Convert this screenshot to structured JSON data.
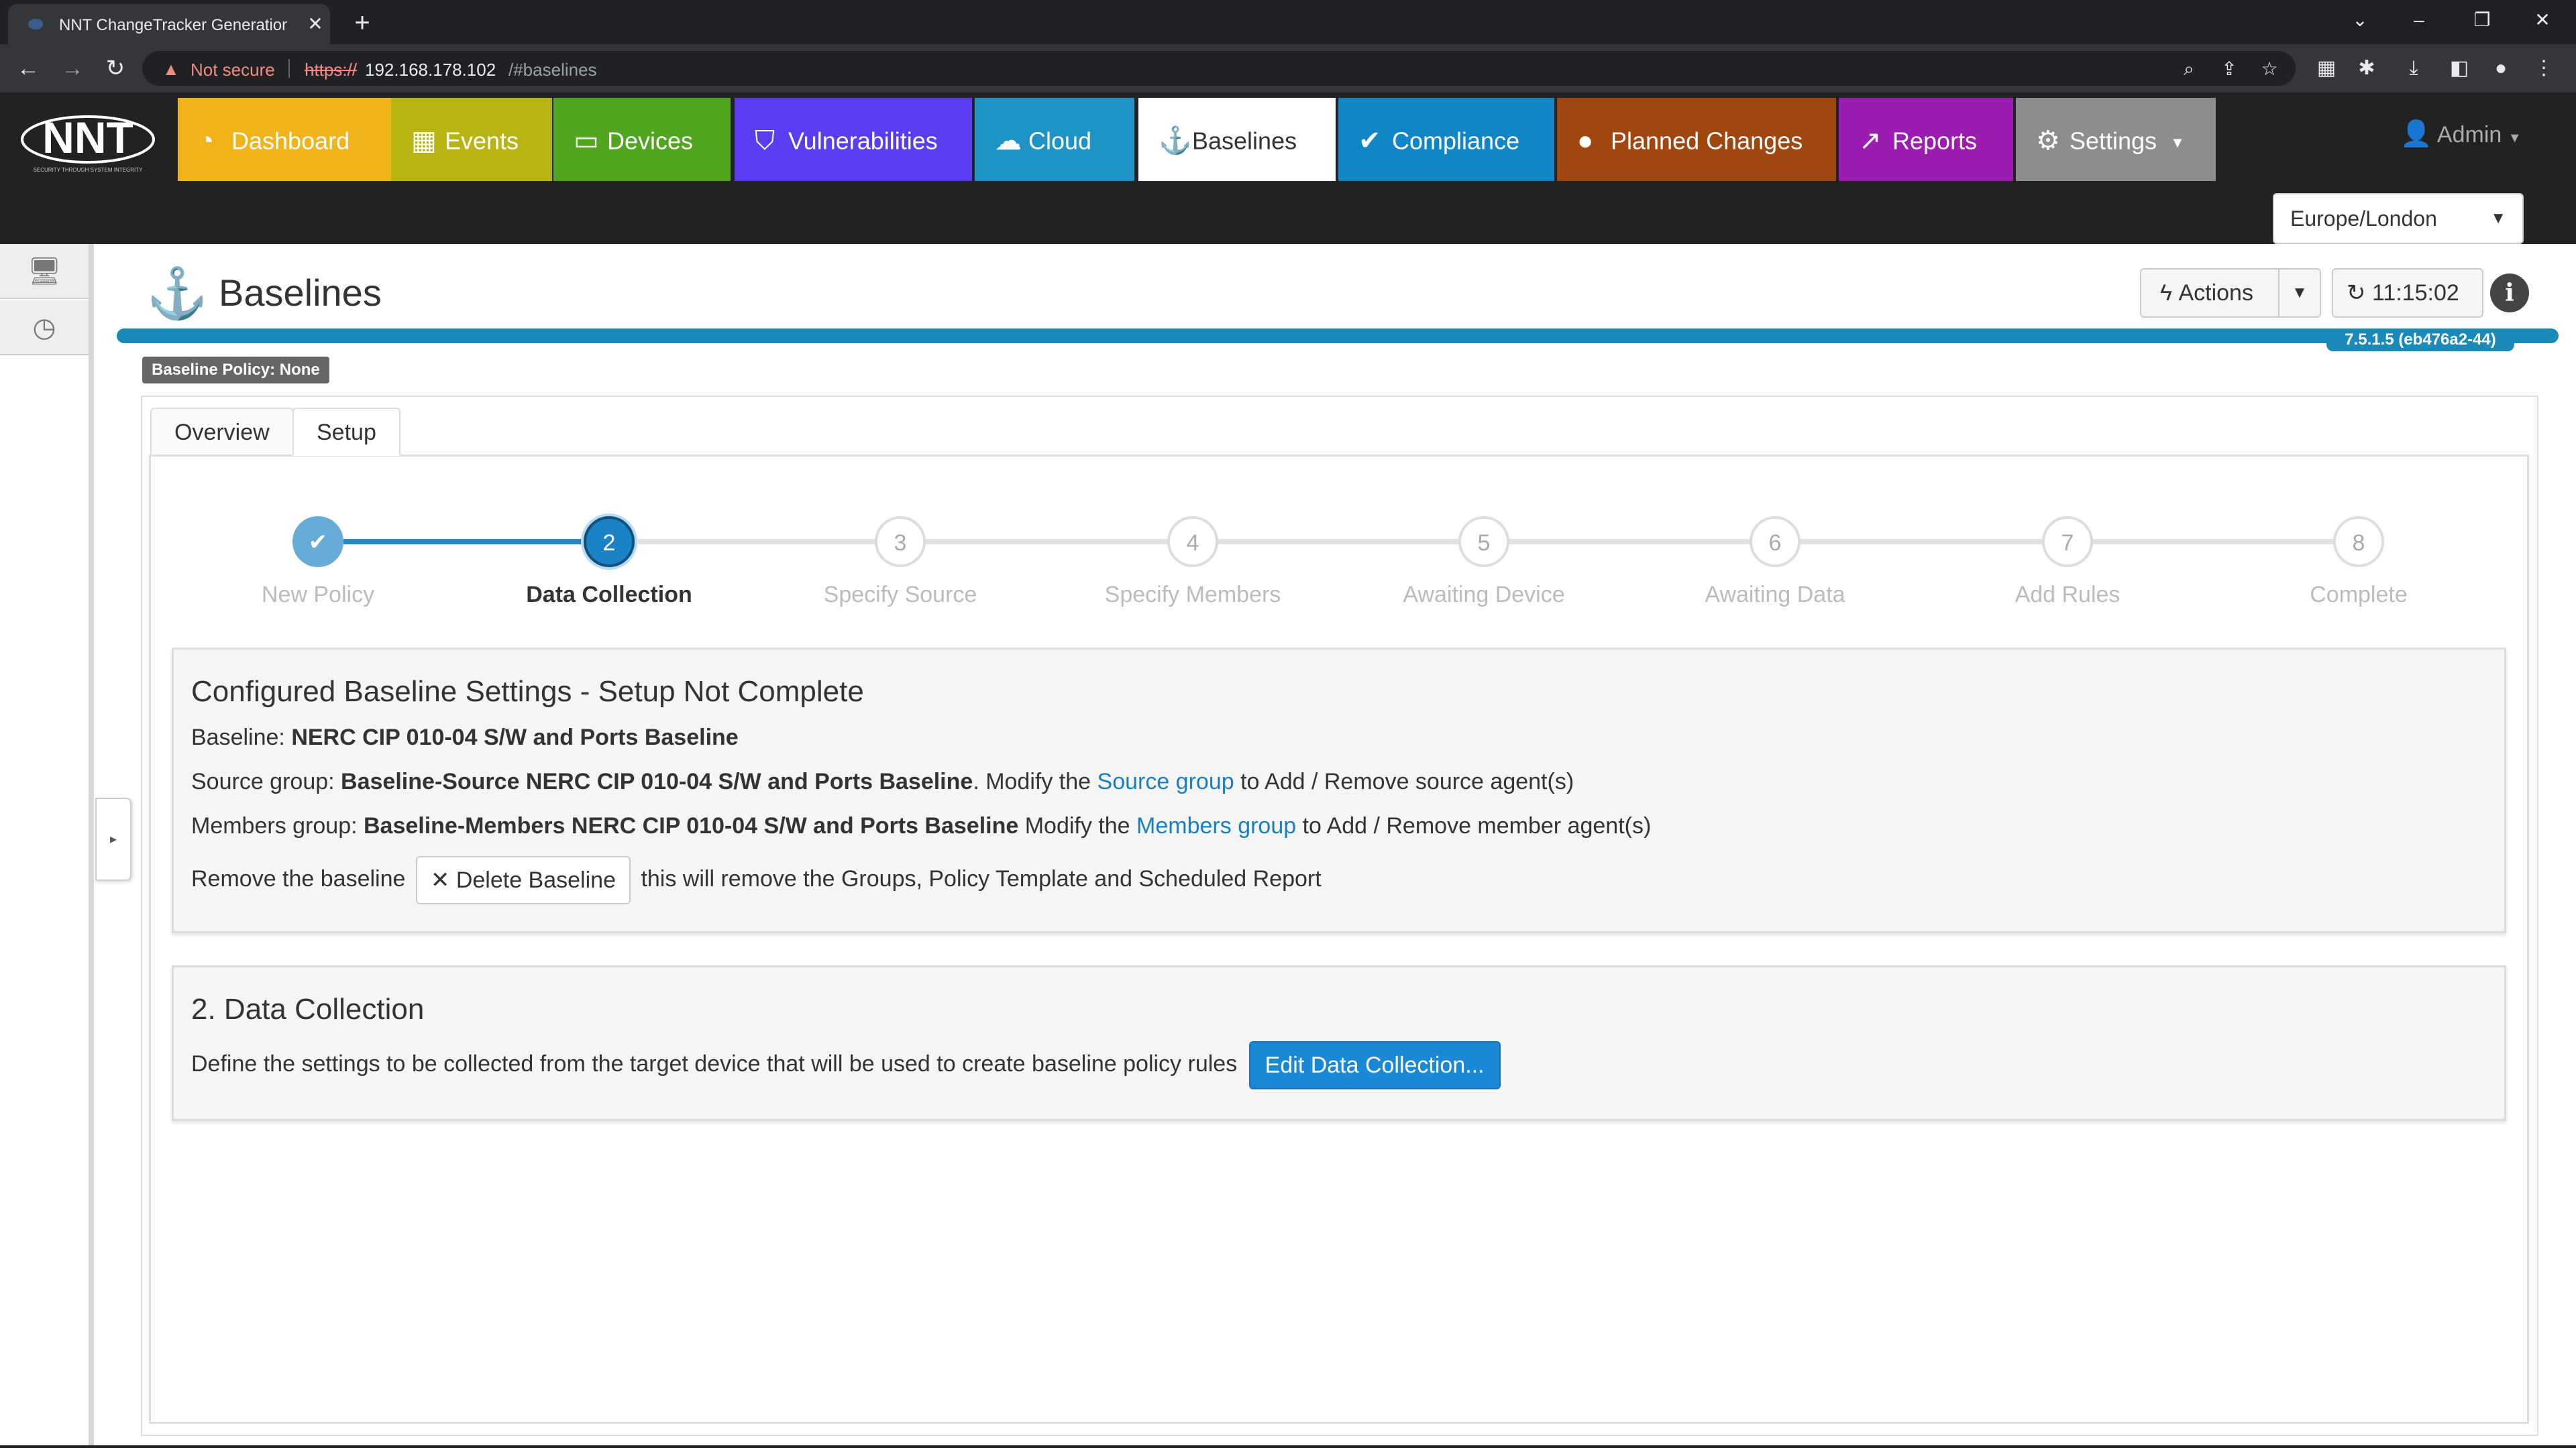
{
  "browser": {
    "tab_title": "NNT ChangeTracker Generation",
    "tab_close": "✕",
    "new_tab": "+",
    "security_label": "Not secure",
    "url_scheme": "https://",
    "url_host": "192.168.178.102",
    "url_path": "/#baselines"
  },
  "header": {
    "logo_text": "NNT",
    "logo_tagline": "SECURITY THROUGH SYSTEM INTEGRITY",
    "nav": [
      {
        "label": "Dashboard",
        "icon": "gauge-icon",
        "color": "#f0b41a"
      },
      {
        "label": "Events",
        "icon": "calendar-icon",
        "color": "#b8b414"
      },
      {
        "label": "Devices",
        "icon": "monitor-icon",
        "color": "#52a51e"
      },
      {
        "label": "Vulnerabilities",
        "icon": "shield-icon",
        "color": "#5a3df0"
      },
      {
        "label": "Cloud",
        "icon": "cloud-icon",
        "color": "#1e93c6"
      },
      {
        "label": "Baselines",
        "icon": "anchor-icon",
        "color": "#ffffff"
      },
      {
        "label": "Compliance",
        "icon": "check-icon",
        "color": "#1186c6"
      },
      {
        "label": "Planned Changes",
        "icon": "speech-bubble-icon",
        "color": "#a0470f"
      },
      {
        "label": "Reports",
        "icon": "chart-icon",
        "color": "#9c1bb0"
      },
      {
        "label": "Settings",
        "icon": "gear-icon",
        "color": "#8d8d8d"
      }
    ],
    "admin_label": "Admin",
    "timezone": "Europe/London"
  },
  "page": {
    "title": "Baselines",
    "actions_label": "Actions",
    "refresh_time": "11:15:02",
    "version": "7.5.1.5 (eb476a2-44)",
    "policy_badge": "Baseline Policy: None",
    "tabs": [
      {
        "label": "Overview",
        "active": false
      },
      {
        "label": "Setup",
        "active": true
      }
    ]
  },
  "stepper": {
    "steps": [
      {
        "number": "1",
        "label": "New Policy",
        "state": "done"
      },
      {
        "number": "2",
        "label": "Data Collection",
        "state": "active"
      },
      {
        "number": "3",
        "label": "Specify Source",
        "state": "pending"
      },
      {
        "number": "4",
        "label": "Specify Members",
        "state": "pending"
      },
      {
        "number": "5",
        "label": "Awaiting Device",
        "state": "pending"
      },
      {
        "number": "6",
        "label": "Awaiting Data",
        "state": "pending"
      },
      {
        "number": "7",
        "label": "Add Rules",
        "state": "pending"
      },
      {
        "number": "8",
        "label": "Complete",
        "state": "pending"
      }
    ]
  },
  "settings_card": {
    "title": "Configured Baseline Settings - Setup Not Complete",
    "baseline_label": "Baseline:",
    "baseline_value": "NERC CIP 010-04 S/W and Ports Baseline",
    "source_label": "Source group:",
    "source_value": "Baseline-Source NERC CIP 010-04 S/W and Ports Baseline",
    "source_mid": ". Modify the",
    "source_link": "Source group",
    "source_tail": "to Add / Remove source agent(s)",
    "members_label": "Members group:",
    "members_value": "Baseline-Members NERC CIP 010-04 S/W and Ports Baseline",
    "members_mid": "Modify the",
    "members_link": "Members group",
    "members_tail": "to Add / Remove member agent(s)",
    "remove_prefix": "Remove the baseline",
    "delete_label": "Delete Baseline",
    "remove_suffix": "this will remove the Groups, Policy Template and Scheduled Report"
  },
  "data_card": {
    "title": "2. Data Collection",
    "description": "Define the settings to be collected from the target device that will be used to create baseline policy rules",
    "edit_label": "Edit Data Collection..."
  }
}
